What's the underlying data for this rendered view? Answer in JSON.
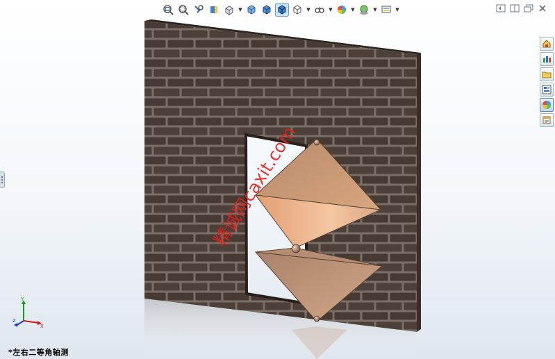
{
  "window": {
    "controls": [
      "collapse-icon",
      "split-icon",
      "restore-icon",
      "close-icon"
    ]
  },
  "heads_up_toolbar": {
    "tools": [
      {
        "name": "zoom-to-fit-icon"
      },
      {
        "name": "zoom-to-area-icon"
      },
      {
        "name": "previous-view-icon"
      },
      {
        "name": "section-view-icon"
      },
      {
        "name": "view-orientation-icon",
        "dropdown": true
      },
      {
        "name": "display-style-shaded-icon"
      },
      {
        "name": "display-style-edges-icon"
      },
      {
        "name": "display-style-active-icon",
        "active": true
      },
      {
        "name": "hide-show-items-icon",
        "dropdown": true
      },
      {
        "name": "edit-appearance-icon",
        "dropdown": true
      },
      {
        "name": "apply-scene-icon",
        "dropdown": true
      },
      {
        "name": "view-settings-icon",
        "dropdown": true
      },
      {
        "name": "display-manager-icon",
        "dropdown": true
      }
    ]
  },
  "task_pane": {
    "tabs": [
      {
        "name": "resources-icon"
      },
      {
        "name": "design-library-icon"
      },
      {
        "name": "file-explorer-icon"
      },
      {
        "name": "view-palette-icon"
      },
      {
        "name": "appearances-icon",
        "active": true
      },
      {
        "name": "custom-properties-icon"
      }
    ]
  },
  "watermark": {
    "text": "精诚网caxit.com",
    "color": "#e8201a"
  },
  "triad": {
    "axes": {
      "x": "X",
      "y": "Y",
      "z": "Z"
    },
    "colors": {
      "x": "#d11a1a",
      "y": "#11a01c",
      "z": "#1a3fd1"
    }
  },
  "view": {
    "label": "*左右二等角轴测"
  },
  "colors": {
    "brick": "#4a3c35",
    "mortar": "#7c7069",
    "panel_light": "#e8b58d",
    "panel_mid": "#c69474",
    "panel_dark": "#9d7056"
  }
}
